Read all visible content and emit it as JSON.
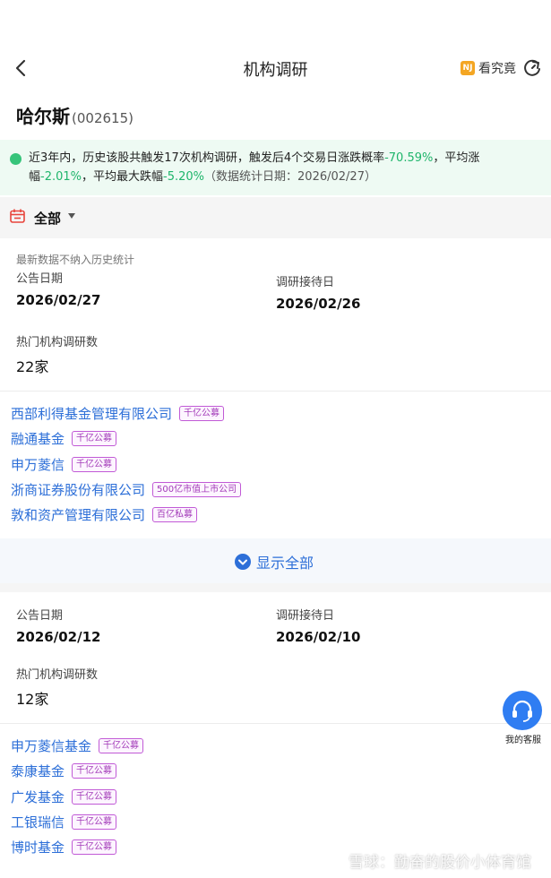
{
  "header": {
    "title": "机构调研",
    "kanjiujing_label": "看究竟",
    "kanjiujing_logo": "NJ"
  },
  "stock": {
    "name": "哈尔斯",
    "code": "(002615)"
  },
  "summary": {
    "line1_a": "近3年内，历史该股共触发17次机构调研，触发后4个交易日涨跌概率",
    "rate": "-70.59%",
    "line1_b": "，平均涨",
    "line2_a": "幅",
    "avg_change": "-2.01%",
    "line2_b": "，平均最大跌幅",
    "max_drop": "-5.20%",
    "date_note": "（数据统计日期：2026/02/27）"
  },
  "filter": {
    "label": "全部"
  },
  "record1": {
    "note": "最新数据不纳入历史统计",
    "announce_label": "公告日期",
    "announce_date": "2026/02/27",
    "reception_label": "调研接待日",
    "reception_date": "2026/02/26",
    "count_label": "热门机构调研数",
    "count": "22家",
    "institutions": [
      {
        "name": "西部利得基金管理有限公司",
        "tag": "千亿公募"
      },
      {
        "name": "融通基金",
        "tag": "千亿公募"
      },
      {
        "name": "申万菱信",
        "tag": "千亿公募"
      },
      {
        "name": "浙商证券股份有限公司",
        "tag": "500亿市值上市公司"
      },
      {
        "name": "敦和资产管理有限公司",
        "tag": "百亿私募"
      }
    ],
    "show_all": "显示全部"
  },
  "record2": {
    "announce_label": "公告日期",
    "announce_date": "2026/02/12",
    "reception_label": "调研接待日",
    "reception_date": "2026/02/10",
    "count_label": "热门机构调研数",
    "count": "12家",
    "institutions": [
      {
        "name": "申万菱信基金",
        "tag": "千亿公募"
      },
      {
        "name": "泰康基金",
        "tag": "千亿公募"
      },
      {
        "name": "广发基金",
        "tag": "千亿公募"
      },
      {
        "name": "工银瑞信",
        "tag": "千亿公募"
      },
      {
        "name": "博时基金",
        "tag": "千亿公募"
      }
    ]
  },
  "customer_service": {
    "label": "我的客服"
  },
  "watermark": {
    "text": "雪球：勤奋的股价小体育馆"
  },
  "colors": {
    "link": "#2d6fd8",
    "green": "#1fb56b",
    "tag": "#a23ab8"
  }
}
